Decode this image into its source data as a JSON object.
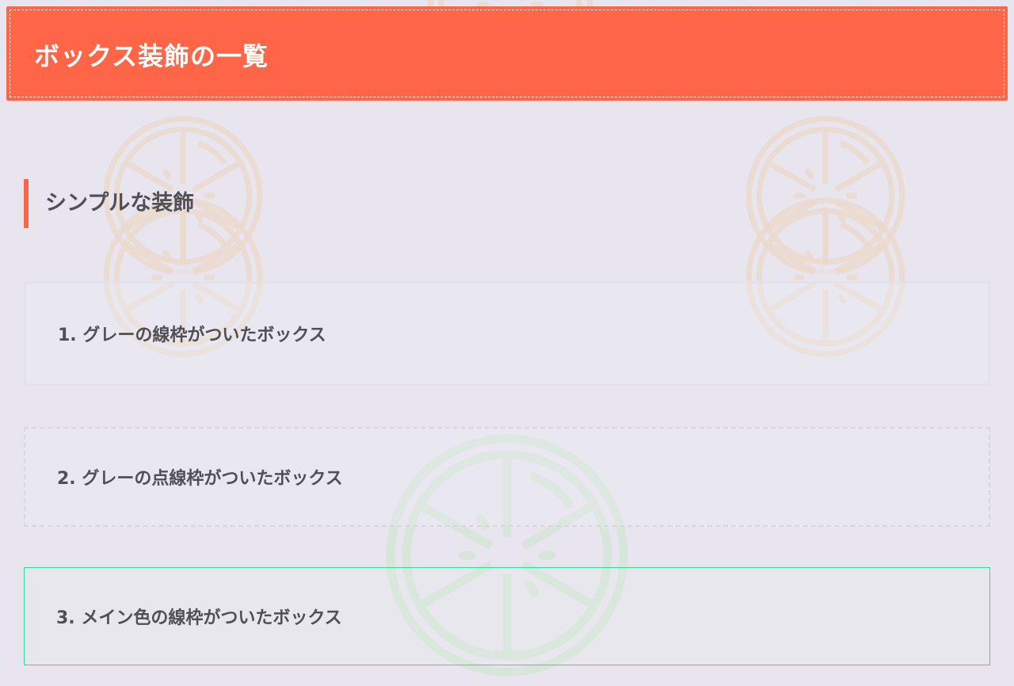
{
  "header": {
    "title": "ボックス装飾の一覧"
  },
  "section": {
    "title": "シンプルな装飾"
  },
  "boxes": [
    {
      "label": "1. グレーの線枠がついたボックス"
    },
    {
      "label": "2. グレーの点線枠がついたボックス"
    },
    {
      "label": "3. メイン色の線枠がついたボックス"
    }
  ],
  "colors": {
    "accent": "#ff6647",
    "main": "#35d997",
    "background": "#e8e5ee",
    "text": "#4f4f55",
    "decoration_orange": "#ecd9cb",
    "decoration_green": "#d5e6d8"
  },
  "decorations": {
    "icon": "orange-slice-icon"
  }
}
